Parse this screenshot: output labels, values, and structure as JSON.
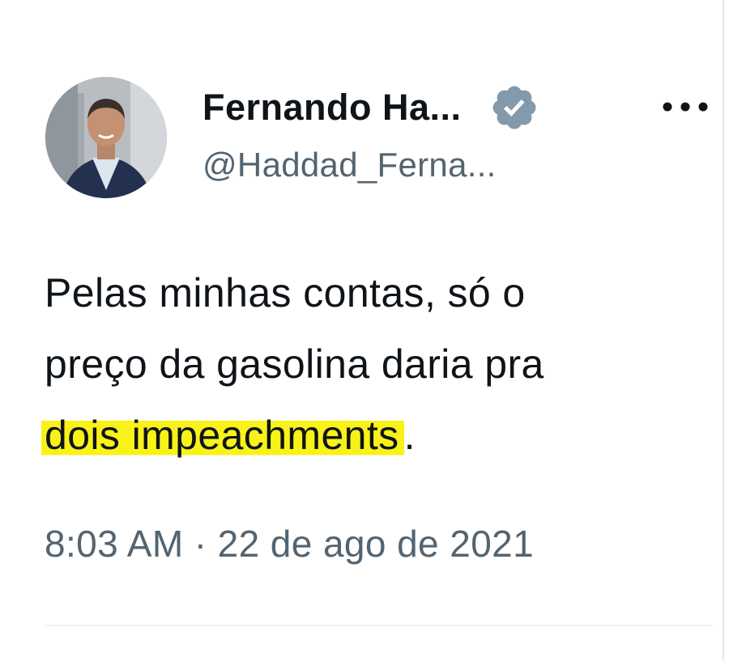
{
  "tweet": {
    "author": {
      "display_name": "Fernando Ha...",
      "handle": "@Haddad_Ferna...",
      "verified": true,
      "avatar_icon": "user-avatar-photo"
    },
    "text": {
      "line1": "Pelas minhas contas, só o",
      "line2": "preço da gasolina daria pra",
      "line3_highlighted": "dois impeachments",
      "line3_tail": "."
    },
    "timestamp": "8:03 AM · 22 de ago de 2021",
    "more_icon": "more-horizontal-icon"
  },
  "colors": {
    "text_primary": "#0f1419",
    "text_secondary": "#536471",
    "verified_badge": "#829aab",
    "highlight": "#f8f218"
  }
}
